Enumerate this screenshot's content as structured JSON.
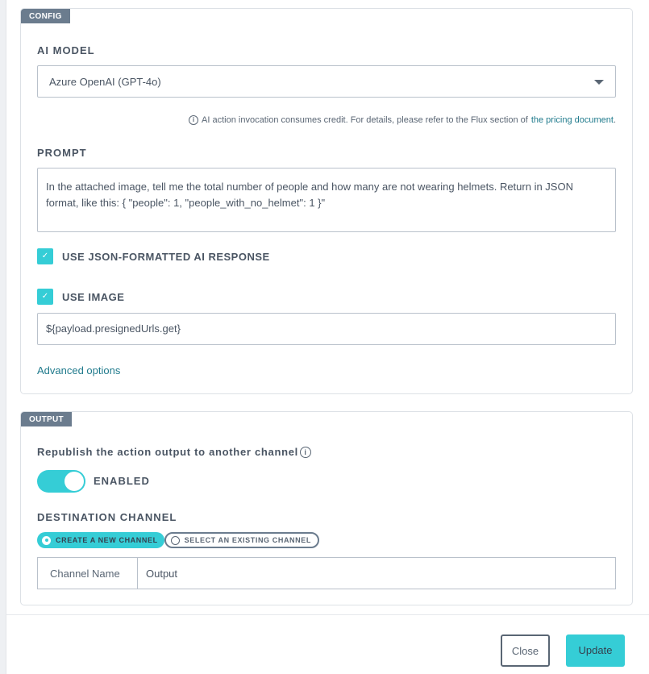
{
  "config": {
    "tag": "CONFIG",
    "ai_model": {
      "label": "AI MODEL",
      "selected": "Azure OpenAI (GPT-4o)"
    },
    "note": {
      "text": "AI action invocation consumes credit. For details, please refer to the Flux section of",
      "link": "the pricing document",
      "suffix": "."
    },
    "prompt": {
      "label": "PROMPT",
      "value": "In the attached image, tell me the total number of people and how many are not wearing helmets. Return in JSON format, like this: { \"people\": 1, \"people_with_no_helmet\": 1 }\""
    },
    "use_json": {
      "label": "USE JSON-FORMATTED AI RESPONSE",
      "checked": true
    },
    "use_image": {
      "label": "USE IMAGE",
      "checked": true,
      "value": "${payload.presignedUrls.get}"
    },
    "advanced_options": "Advanced options"
  },
  "output": {
    "tag": "OUTPUT",
    "republish_label": "Republish the action output to another channel",
    "toggle": {
      "enabled": true,
      "label": "ENABLED"
    },
    "destination": {
      "label": "DESTINATION CHANNEL",
      "options": [
        "CREATE A NEW CHANNEL",
        "SELECT AN EXISTING CHANNEL"
      ],
      "selected": "CREATE A NEW CHANNEL"
    },
    "channel_name": {
      "label": "Channel Name",
      "value": "Output"
    }
  },
  "footer": {
    "close": "Close",
    "update": "Update"
  },
  "colors": {
    "accent": "#35cdd6",
    "tag_bg": "#6b7c8e",
    "link": "#1f7a8c",
    "text": "#4a5563"
  }
}
